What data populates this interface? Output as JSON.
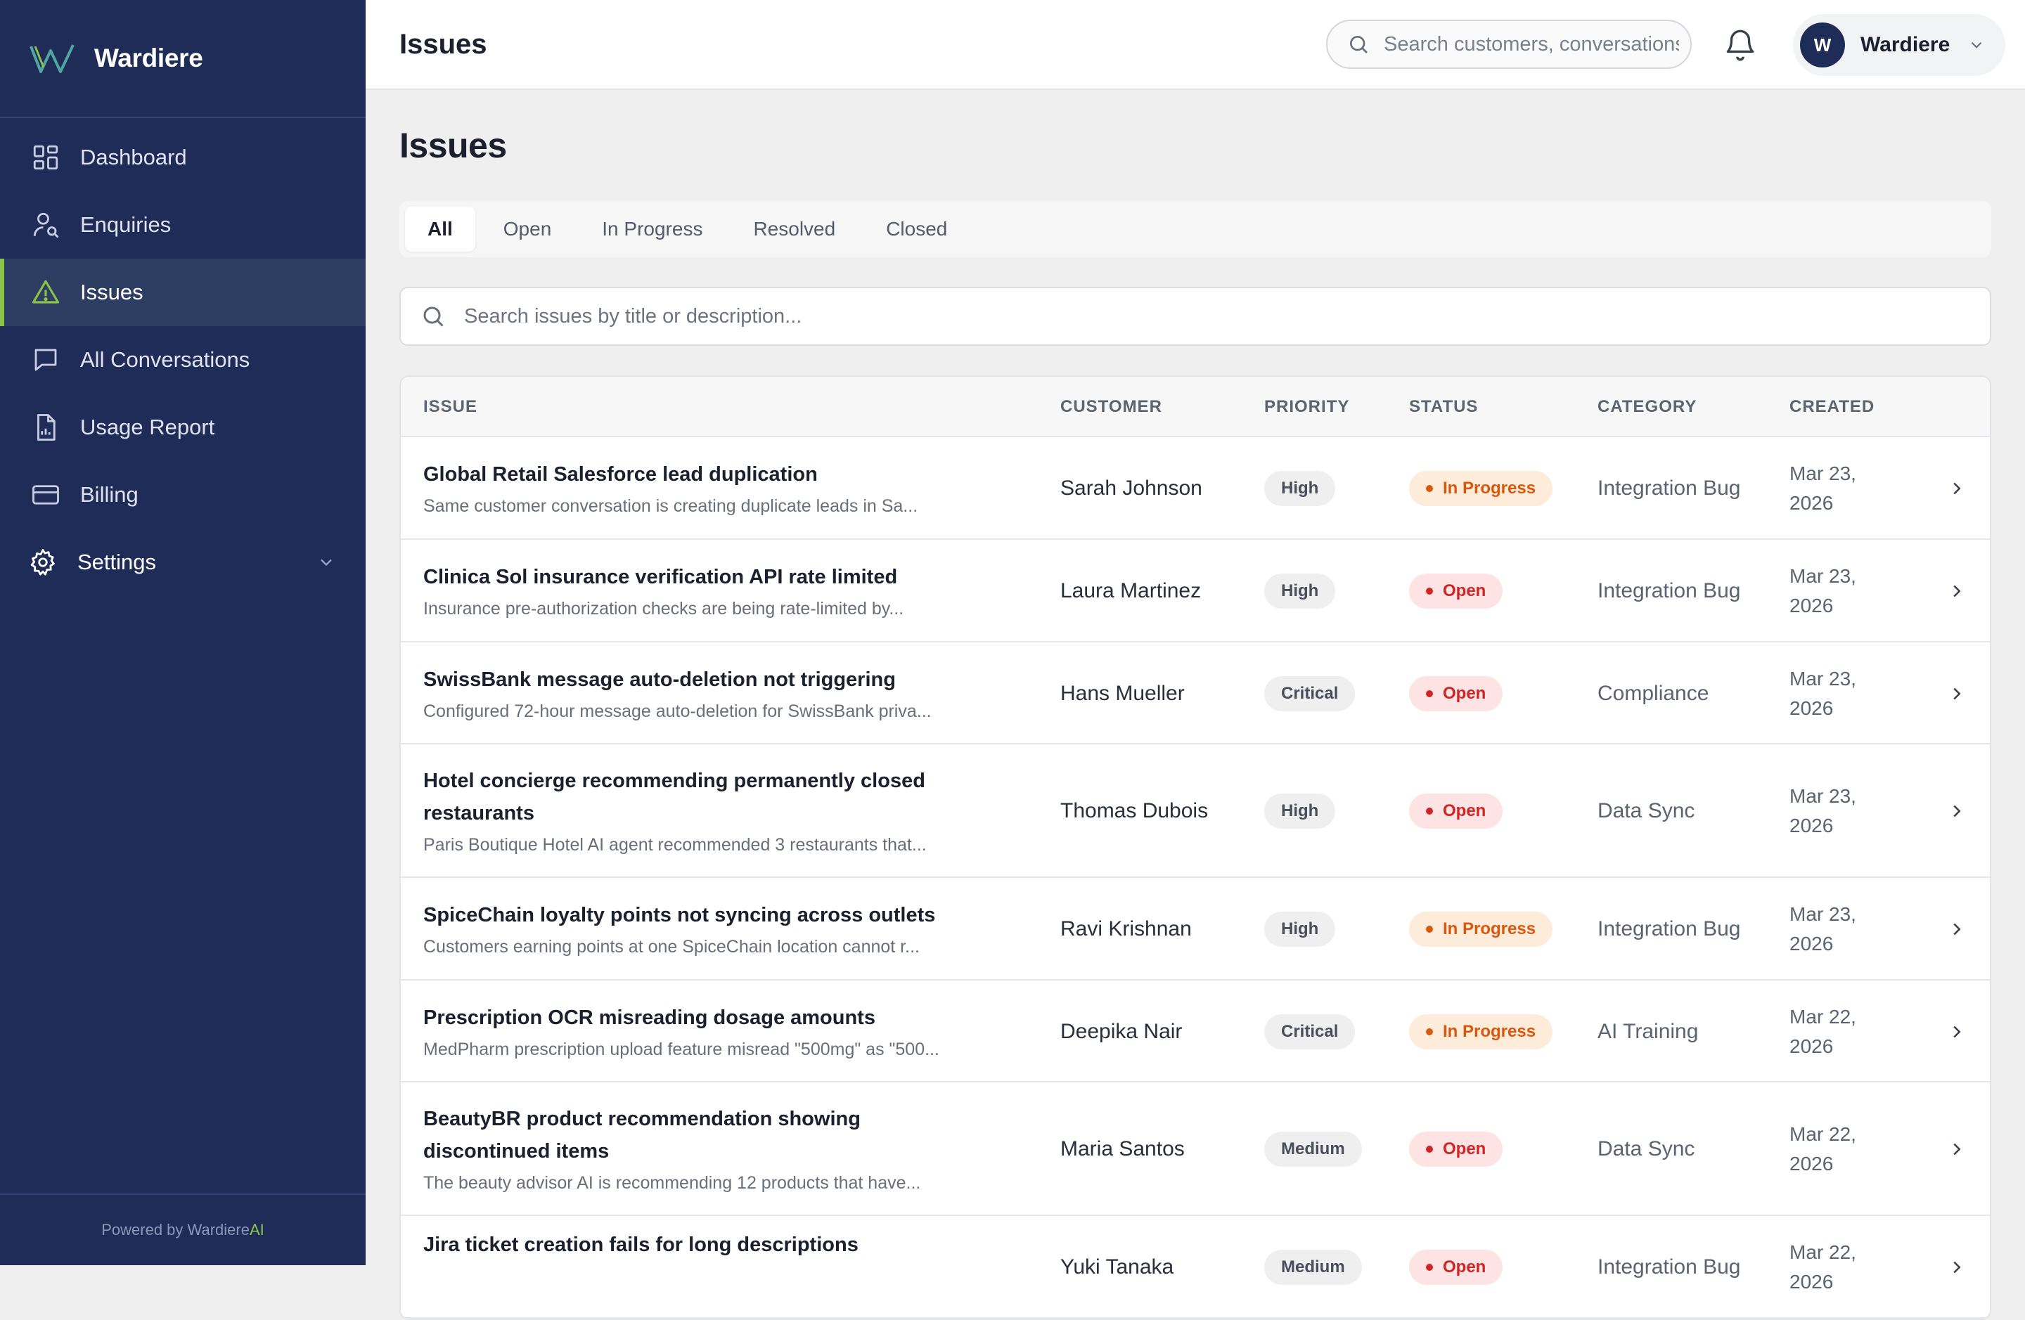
{
  "brand": {
    "name": "Wardiere",
    "logo": "W"
  },
  "sidebar": {
    "items": [
      {
        "label": "Dashboard",
        "icon": "dashboard-grid-icon"
      },
      {
        "label": "Enquiries",
        "icon": "user-search-icon"
      },
      {
        "label": "Issues",
        "icon": "warning-triangle-icon",
        "active": true
      },
      {
        "label": "All Conversations",
        "icon": "chat-bubble-icon"
      },
      {
        "label": "Usage Report",
        "icon": "report-document-icon"
      },
      {
        "label": "Billing",
        "icon": "credit-card-icon"
      },
      {
        "label": "Settings",
        "icon": "gear-icon",
        "expandable": true
      }
    ],
    "footer_prefix": "Powered by Wardiere",
    "footer_suffix": "AI"
  },
  "header": {
    "title": "Issues",
    "search_placeholder": "Search customers, conversations...",
    "user_initial": "W",
    "user_name": "Wardiere"
  },
  "main": {
    "title": "Issues",
    "tabs": [
      {
        "label": "All",
        "active": true
      },
      {
        "label": "Open"
      },
      {
        "label": "In Progress"
      },
      {
        "label": "Resolved"
      },
      {
        "label": "Closed"
      }
    ],
    "search_placeholder": "Search issues by title or description...",
    "columns": [
      "ISSUE",
      "CUSTOMER",
      "PRIORITY",
      "STATUS",
      "CATEGORY",
      "CREATED"
    ],
    "rows": [
      {
        "title": "Global Retail Salesforce lead duplication",
        "desc": "Same customer conversation is creating duplicate leads in Sa...",
        "customer": "Sarah Johnson",
        "priority": "High",
        "status": "In Progress",
        "category": "Integration Bug",
        "created_line1": "Mar 23,",
        "created_line2": "2026"
      },
      {
        "title": "Clinica Sol insurance verification API rate limited",
        "desc": "Insurance pre-authorization checks are being rate-limited by...",
        "customer": "Laura Martinez",
        "priority": "High",
        "status": "Open",
        "category": "Integration Bug",
        "created_line1": "Mar 23,",
        "created_line2": "2026"
      },
      {
        "title": "SwissBank message auto-deletion not triggering",
        "desc": "Configured 72-hour message auto-deletion for SwissBank priva...",
        "customer": "Hans Mueller",
        "priority": "Critical",
        "status": "Open",
        "category": "Compliance",
        "created_line1": "Mar 23,",
        "created_line2": "2026"
      },
      {
        "title": "Hotel concierge recommending permanently closed restaurants",
        "desc": "Paris Boutique Hotel AI agent recommended 3 restaurants that...",
        "customer": "Thomas Dubois",
        "priority": "High",
        "status": "Open",
        "category": "Data Sync",
        "created_line1": "Mar 23,",
        "created_line2": "2026"
      },
      {
        "title": "SpiceChain loyalty points not syncing across outlets",
        "desc": "Customers earning points at one SpiceChain location cannot r...",
        "customer": "Ravi Krishnan",
        "priority": "High",
        "status": "In Progress",
        "category": "Integration Bug",
        "created_line1": "Mar 23,",
        "created_line2": "2026"
      },
      {
        "title": "Prescription OCR misreading dosage amounts",
        "desc": "MedPharm prescription upload feature misread \"500mg\" as \"500...",
        "customer": "Deepika Nair",
        "priority": "Critical",
        "status": "In Progress",
        "category": "AI Training",
        "created_line1": "Mar 22,",
        "created_line2": "2026"
      },
      {
        "title": "BeautyBR product recommendation showing discontinued items",
        "desc": "The beauty advisor AI is recommending 12 products that have...",
        "customer": "Maria Santos",
        "priority": "Medium",
        "status": "Open",
        "category": "Data Sync",
        "created_line1": "Mar 22,",
        "created_line2": "2026"
      },
      {
        "title": "Jira ticket creation fails for long descriptions",
        "desc": "",
        "customer": "Yuki Tanaka",
        "priority": "Medium",
        "status": "Open",
        "category": "Integration Bug",
        "created_line1": "Mar 22,",
        "created_line2": "2026"
      }
    ]
  },
  "colors": {
    "sidebar_bg": "#1f2c58",
    "active_accent": "#8bc34a",
    "in_progress": "#d9580f",
    "open": "#cf2525"
  }
}
